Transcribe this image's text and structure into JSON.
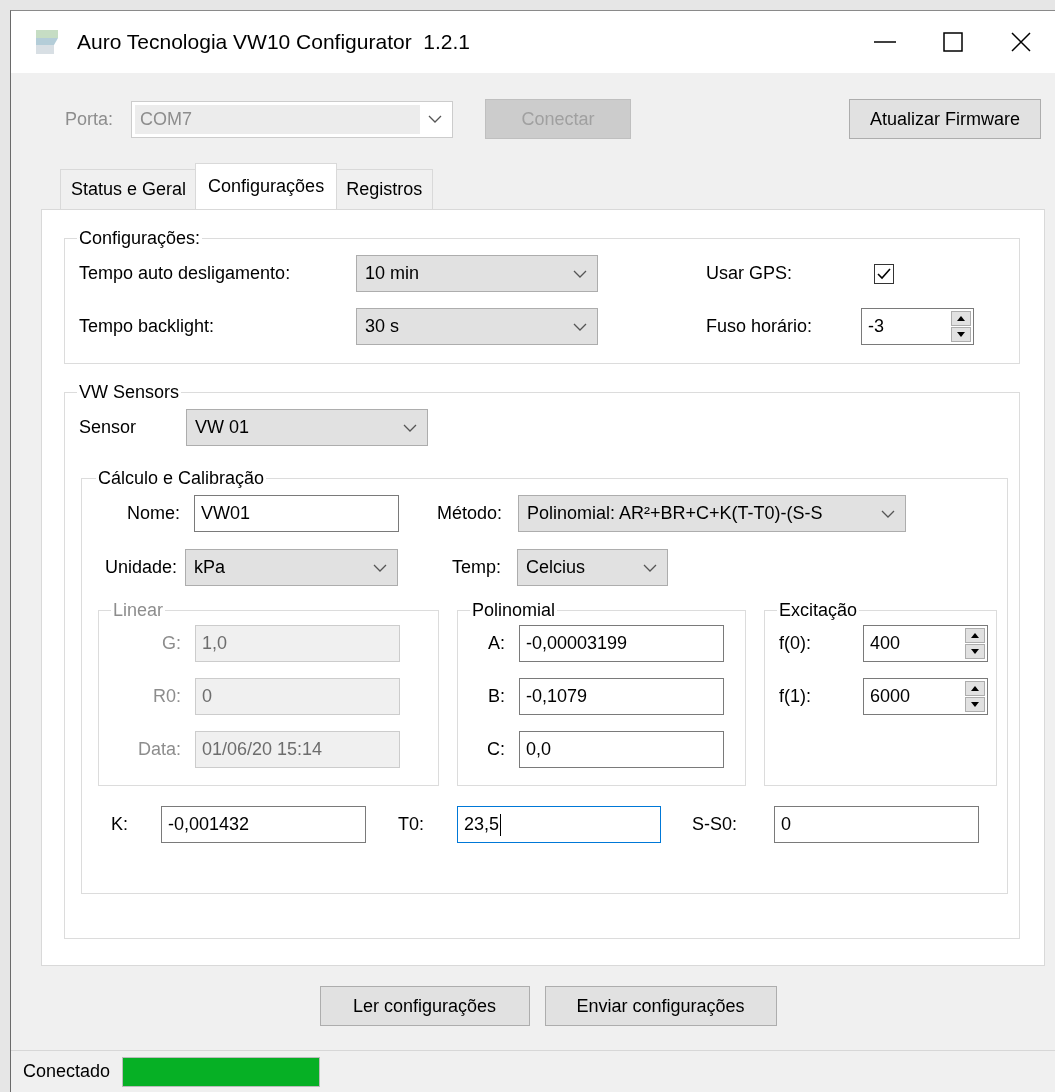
{
  "window": {
    "title": "Auro Tecnologia VW10 Configurator  1.2.1"
  },
  "connection": {
    "label": "Porta:",
    "port": "COM7",
    "disabled": true,
    "buttons": [
      {
        "label": "Conectar",
        "disabled": true
      },
      {
        "label": "Atualizar Firmware",
        "disabled": false
      }
    ]
  },
  "tabs": [
    {
      "label": "Status e Geral",
      "selected": false
    },
    {
      "label": "Configurações",
      "selected": true
    },
    {
      "label": "Registros",
      "selected": false
    }
  ],
  "settings": {
    "title": "Configurações:",
    "combos": [
      {
        "label": "Tempo auto desligamento:",
        "value": "10 min"
      },
      {
        "label": "Tempo backlight:",
        "value": "30 s"
      }
    ],
    "gps": {
      "label": "Usar GPS:",
      "checked": true
    },
    "timezone": {
      "label": "Fuso horário:",
      "value": "-3"
    }
  },
  "sensors": {
    "title": "VW Sensors",
    "sensor": {
      "label": "Sensor",
      "value": "VW 01"
    },
    "calc": {
      "title": "Cálculo e Calibração",
      "name": {
        "label": "Nome:",
        "value": "VW01"
      },
      "method": {
        "label": "Método:",
        "value": "Polinomial: AR²+BR+C+K(T-T0)-(S-S"
      },
      "unit": {
        "label": "Unidade:",
        "value": "kPa"
      },
      "temp": {
        "label": "Temp:",
        "value": "Celcius"
      },
      "groups": [
        {
          "kind": "fields",
          "title": "Linear",
          "disabled": true,
          "fields": [
            {
              "label": "G:",
              "value": "1,0"
            },
            {
              "label": "R0:",
              "value": "0"
            },
            {
              "label": "Data:",
              "value": "01/06/20 15:14"
            }
          ]
        },
        {
          "kind": "fields",
          "title": "Polinomial",
          "disabled": false,
          "fields": [
            {
              "label": "A:",
              "value": "-0,00003199"
            },
            {
              "label": "B:",
              "value": "-0,1079"
            },
            {
              "label": "C:",
              "value": "0,0"
            }
          ]
        },
        {
          "kind": "spinners",
          "title": "Excitação",
          "disabled": false,
          "fields": [
            {
              "label": "f(0):",
              "value": "400"
            },
            {
              "label": "f(1):",
              "value": "6000"
            }
          ]
        }
      ],
      "bottom": [
        {
          "label": "K:",
          "value": "-0,001432",
          "focused": false
        },
        {
          "label": "T0:",
          "value": "23,5",
          "focused": true
        },
        {
          "label": "S-S0:",
          "value": "0",
          "focused": false
        }
      ]
    }
  },
  "actions": [
    "Ler configurações",
    "Enviar configurações"
  ],
  "status_bar": {
    "text": "Conectado",
    "level": 1
  }
}
